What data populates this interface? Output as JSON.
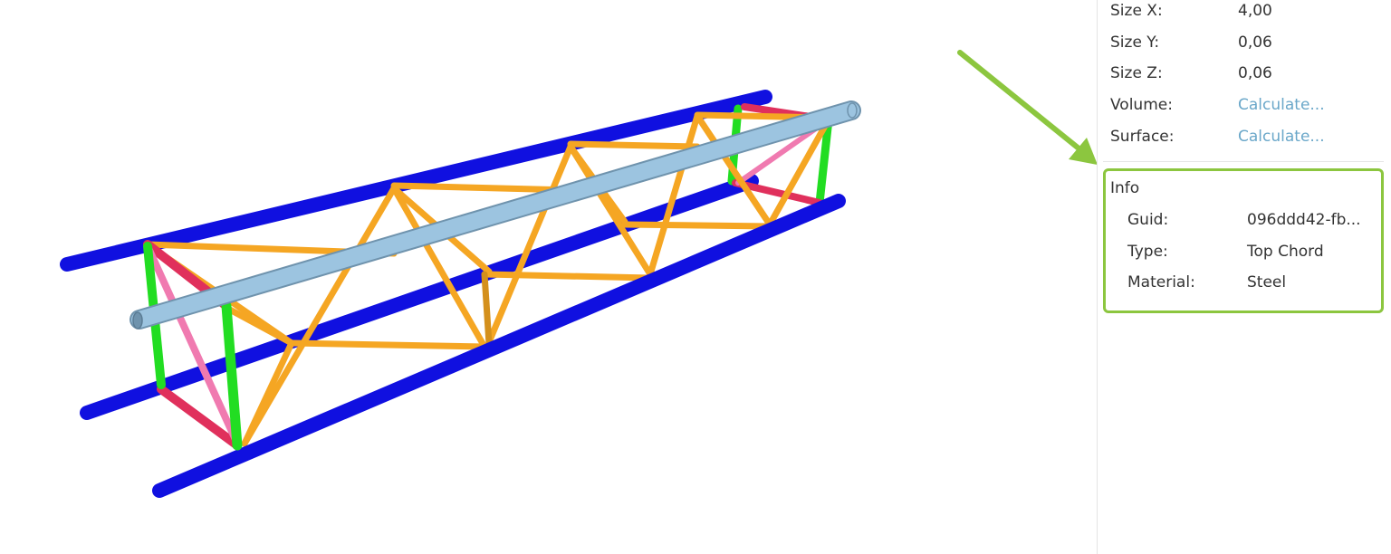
{
  "properties": [
    {
      "label": "Size X:",
      "value": "4,00",
      "link": false
    },
    {
      "label": "Size Y:",
      "value": "0,06",
      "link": false
    },
    {
      "label": "Size Z:",
      "value": "0,06",
      "link": false
    },
    {
      "label": "Volume:",
      "value": "Calculate...",
      "link": true
    },
    {
      "label": "Surface:",
      "value": "Calculate...",
      "link": true
    }
  ],
  "info": {
    "title": "Info",
    "rows": [
      {
        "label": "Guid:",
        "value": "096ddd42-fb..."
      },
      {
        "label": "Type:",
        "value": "Top Chord"
      },
      {
        "label": "Material:",
        "value": "Steel"
      }
    ]
  },
  "colors": {
    "chord": "#1010e0",
    "top_chord": "#9cc4e0",
    "post": "#22dd22",
    "web": "#f5a623",
    "end_brace": "#e0305c",
    "end_diagonal": "#f07ab0",
    "annotation": "#8cc63f",
    "link": "#6aa7c9"
  },
  "icons": {
    "annotation_arrow": "arrow-icon"
  }
}
